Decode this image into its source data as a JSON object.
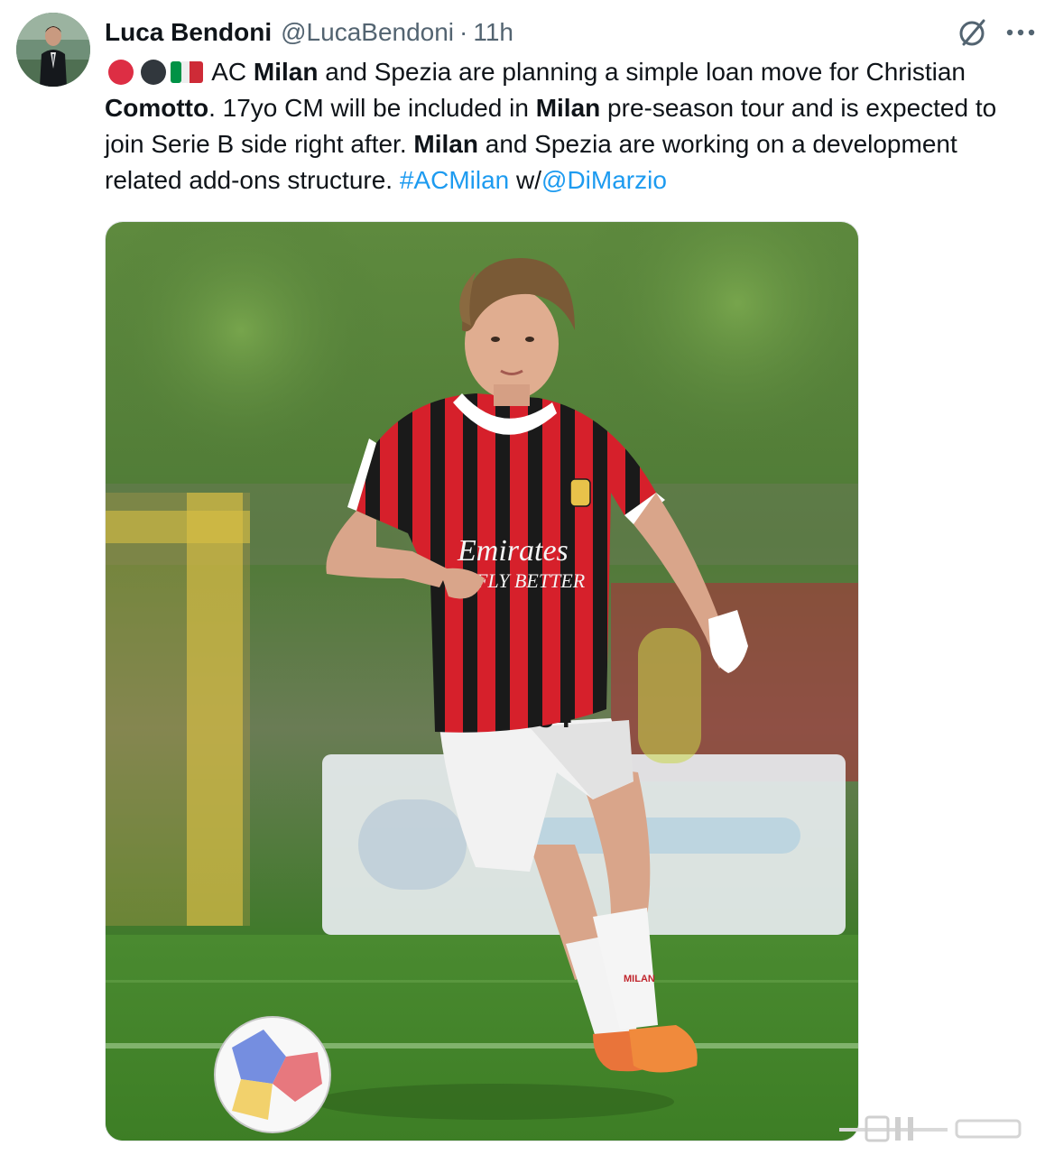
{
  "author": {
    "display_name": "Luca Bendoni",
    "handle": "@LucaBendoni",
    "separator": "·",
    "time": "11h"
  },
  "actions": {
    "grok_icon": "slashed-circle-icon",
    "more_icon": "more-horizontal-icon"
  },
  "tweet": {
    "emoji": [
      "red-circle",
      "black-circle",
      "italy-flag"
    ],
    "segments": {
      "s1": " AC ",
      "milan1": "Milan",
      "s2": " and Spezia are planning a simple loan move for Christian ",
      "comotto": "Comotto",
      "s3": ". 17yo CM will be included in ",
      "milan2": "Milan",
      "s4": " pre-season tour and is expected to join Serie B side right after. ",
      "milan3": "Milan",
      "s5": " and Spezia are working on a development related add-ons structure. ",
      "hashtag": "#ACMilan",
      "s6": " w/",
      "mention": "@DiMarzio"
    }
  },
  "media": {
    "shirt_sponsor": "Emirates",
    "shirt_tagline": "FLY BETTER",
    "shirt_number": "34",
    "sock_text": "MILAN"
  },
  "colors": {
    "link": "#1d9bf0",
    "text": "#0f1419",
    "secondary": "#536471",
    "milan_red": "#d6202b",
    "milan_black": "#1a1a1a"
  }
}
